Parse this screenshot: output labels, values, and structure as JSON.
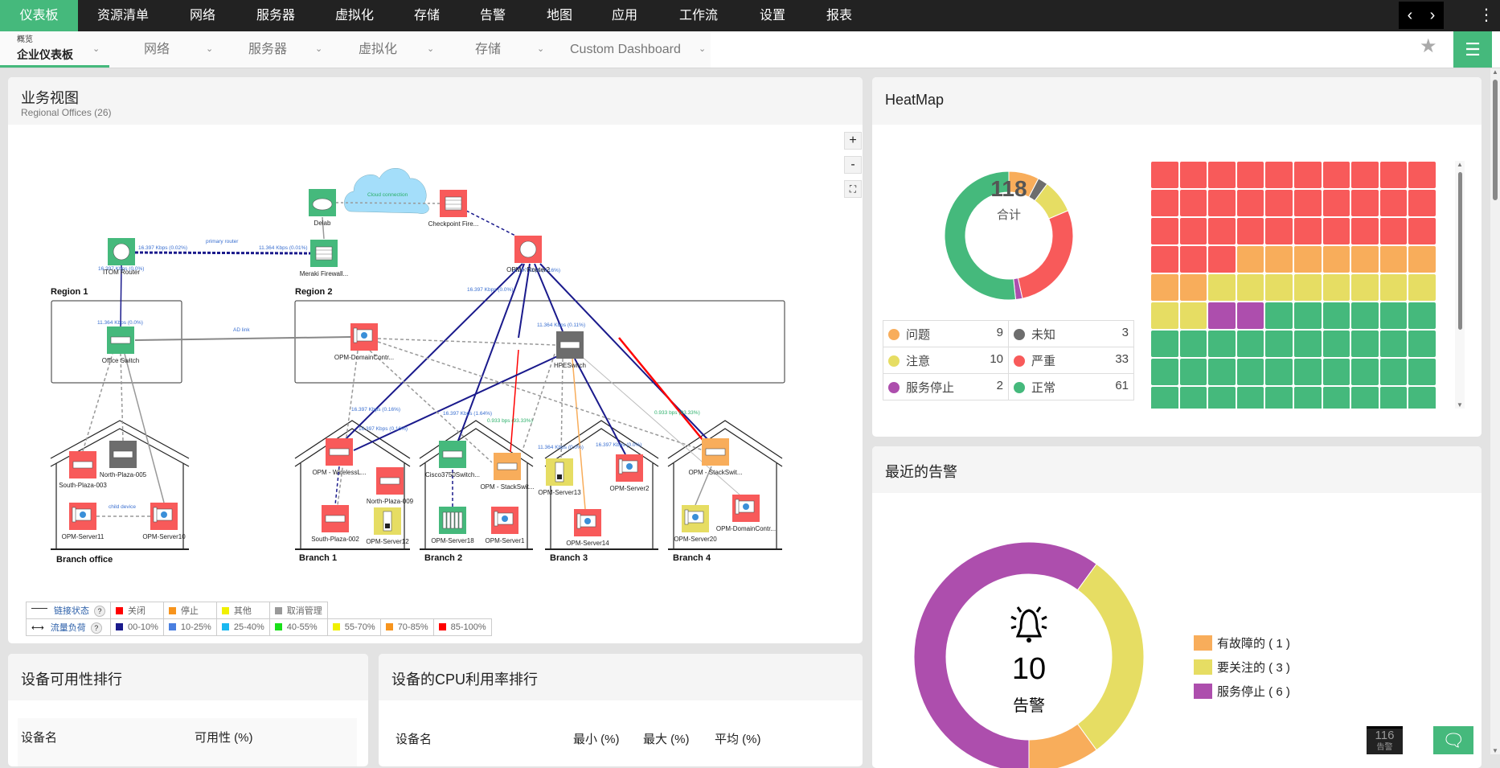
{
  "topnav": {
    "items": [
      "仪表板",
      "资源清单",
      "网络",
      "服务器",
      "虚拟化",
      "存储",
      "告警",
      "地图",
      "应用",
      "工作流",
      "设置",
      "报表"
    ],
    "active": "仪表板"
  },
  "subnav": {
    "overview_small": "概览",
    "tabs": [
      "企业仪表板",
      "网络",
      "服务器",
      "虚拟化",
      "存储",
      "Custom Dashboard"
    ]
  },
  "colors": {
    "critical": "#f85a5a",
    "clear": "#45b97c",
    "trouble": "#f8ad5b",
    "attention": "#e6dd63",
    "unknown": "#6d6d6d",
    "service_down": "#ad4ead",
    "accent": "#45b97c"
  },
  "business_view": {
    "title": "业务视图",
    "subtitle": "Regional Offices (26)",
    "zoom": {
      "plus": "+",
      "minus": "-"
    },
    "regions": [
      "Region 1",
      "Region 2"
    ],
    "branches": [
      "Branch office",
      "Branch 1",
      "Branch 2",
      "Branch 3",
      "Branch 4"
    ],
    "cloud_label": "Cloud connection",
    "link_labels": [
      "16.397 Kbps (0.02%)",
      "primary router",
      "11.364 Kbps (0.01%)",
      "16.397 Kbps (0.0%)",
      "11.364 Kbps (0.0%)",
      "AD link",
      "16.397 Kbps (0.0%)",
      "16.397 Kbps (0.16%)",
      "11.364 Kbps (0.11%)",
      "16.397 Kbps (0.16%)",
      "16.397 Kbps (1.64%)",
      "0.933 bps (93.33%)",
      "11.364 Kbps (0.0%)",
      "16.397 Kbps (0.0%)",
      "0.933 bps (93.33%)",
      "child device",
      "16.397 Kbps (0.16%)"
    ],
    "nodes": [
      {
        "name": "ITOM Router",
        "status": "clear",
        "type": "router"
      },
      {
        "name": "Meraki Firewall...",
        "status": "clear",
        "type": "firewall"
      },
      {
        "name": "Delab",
        "status": "clear",
        "type": "cloud"
      },
      {
        "name": "Checkpoint Fire...",
        "status": "critical",
        "type": "firewall"
      },
      {
        "name": "OPM - Router2",
        "status": "critical",
        "type": "router"
      },
      {
        "name": "Office Switch",
        "status": "clear",
        "type": "switch"
      },
      {
        "name": "OPM-DomainContr...",
        "status": "critical",
        "type": "server"
      },
      {
        "name": "HPESwitch",
        "status": "unknown",
        "type": "switch"
      },
      {
        "name": "South-Plaza-003",
        "status": "critical",
        "type": "switch"
      },
      {
        "name": "North-Plaza-005",
        "status": "unknown",
        "type": "switch"
      },
      {
        "name": "OPM-Server11",
        "status": "critical",
        "type": "server"
      },
      {
        "name": "OPM-Server10",
        "status": "critical",
        "type": "server"
      },
      {
        "name": "OPM - WirelessL...",
        "status": "critical",
        "type": "switch"
      },
      {
        "name": "North-Plaza-009",
        "status": "critical",
        "type": "switch"
      },
      {
        "name": "South-Plaza-002",
        "status": "critical",
        "type": "switch"
      },
      {
        "name": "OPM-Server12",
        "status": "attention",
        "type": "tower"
      },
      {
        "name": "Cisco3750Switch...",
        "status": "clear",
        "type": "switch"
      },
      {
        "name": "OPM - StackSwit...",
        "status": "trouble",
        "type": "switch"
      },
      {
        "name": "OPM-Server18",
        "status": "clear",
        "type": "rack"
      },
      {
        "name": "OPM-Server1",
        "status": "critical",
        "type": "server"
      },
      {
        "name": "OPM-Server13",
        "status": "attention",
        "type": "tower"
      },
      {
        "name": "OPM-Server2",
        "status": "critical",
        "type": "server"
      },
      {
        "name": "OPM-Server14",
        "status": "critical",
        "type": "server"
      },
      {
        "name": "OPM - StackSwit...",
        "status": "trouble",
        "type": "switch"
      },
      {
        "name": "OPM-Server20",
        "status": "attention",
        "type": "server"
      },
      {
        "name": "OPM-DomainContr...",
        "status": "critical",
        "type": "server"
      }
    ],
    "legend": {
      "link_status_label": "链接状态",
      "help": "?",
      "link_status": [
        {
          "label": "关闭",
          "color": "#ff0000"
        },
        {
          "label": "停止",
          "color": "#f7941d"
        },
        {
          "label": "其他",
          "color": "#f0f000"
        },
        {
          "label": "取消管理",
          "color": "#999999"
        }
      ],
      "traffic_label": "流量负荷",
      "traffic": [
        {
          "label": "00-10%",
          "color": "#1a1a8c"
        },
        {
          "label": "10-25%",
          "color": "#4a7fe0"
        },
        {
          "label": "25-40%",
          "color": "#1ab8f0"
        },
        {
          "label": "40-55%",
          "color": "#19e019"
        },
        {
          "label": "55-70%",
          "color": "#f0f000"
        },
        {
          "label": "70-85%",
          "color": "#f7941d"
        },
        {
          "label": "85-100%",
          "color": "#ff0000"
        }
      ]
    }
  },
  "heatmap": {
    "title": "HeatMap",
    "total": "118",
    "total_label": "合计",
    "legend": [
      {
        "label": "问题",
        "value": 9,
        "key": "trouble"
      },
      {
        "label": "未知",
        "value": 3,
        "key": "unknown"
      },
      {
        "label": "注意",
        "value": 10,
        "key": "attention"
      },
      {
        "label": "严重",
        "value": 33,
        "key": "critical"
      },
      {
        "label": "服务停止",
        "value": 2,
        "key": "service_down"
      },
      {
        "label": "正常",
        "value": 61,
        "key": "clear"
      }
    ],
    "donut_order": [
      "trouble",
      "unknown",
      "attention",
      "critical",
      "service_down",
      "clear"
    ],
    "grid_order": [
      "critical",
      "trouble",
      "attention",
      "service_down",
      "clear",
      "unknown"
    ]
  },
  "alarms": {
    "title": "最近的告警",
    "count": "10",
    "count_label": "告警",
    "legend": [
      {
        "label": "有故障的 ( 1 )",
        "value": 1,
        "color": "#f8ad5b"
      },
      {
        "label": "要关注的 ( 3 )",
        "value": 3,
        "color": "#e6dd63"
      },
      {
        "label": "服务停止 ( 6 )",
        "value": 6,
        "color": "#ad4ead"
      }
    ]
  },
  "availability": {
    "title": "设备可用性排行",
    "columns": [
      "设备名",
      "可用性 (%)"
    ]
  },
  "cpu": {
    "title": "设备的CPU利用率排行",
    "columns": [
      "设备名",
      "最小 (%)",
      "最大 (%)",
      "平均 (%)"
    ]
  },
  "floating": {
    "alarm_count": "116",
    "alarm_label": "告警"
  }
}
